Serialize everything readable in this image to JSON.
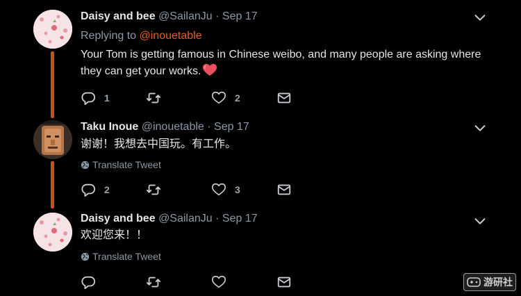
{
  "tweets": [
    {
      "name": "Daisy and bee",
      "handle": "@SailanJu",
      "dot": "·",
      "date": "Sep 17",
      "replying_prefix": "Replying to ",
      "replying_to": "@inouetable",
      "text": "Your Tom is getting famous in Chinese weibo, and many people are asking where they can get your works.",
      "emoji": "heart-emoji",
      "reply_count": "1",
      "retweet_count": "",
      "like_count": "2"
    },
    {
      "name": "Taku Inoue",
      "handle": "@inouetable",
      "dot": "·",
      "date": "Sep 17",
      "text": "谢谢！我想去中国玩。有工作。",
      "translate": "Translate Tweet",
      "reply_count": "2",
      "retweet_count": "",
      "like_count": "3"
    },
    {
      "name": "Daisy and bee",
      "handle": "@SailanJu",
      "dot": "·",
      "date": "Sep 17",
      "text": "欢迎您来！！",
      "translate": "Translate Tweet",
      "reply_count": "",
      "retweet_count": "",
      "like_count": ""
    }
  ],
  "watermark": {
    "text": "游研社",
    "icon": "gamepad-icon"
  },
  "colors": {
    "background": "#000000",
    "thread_line": "#c2521f",
    "mention": "#e0602a",
    "secondary_text": "#8b98a5"
  }
}
